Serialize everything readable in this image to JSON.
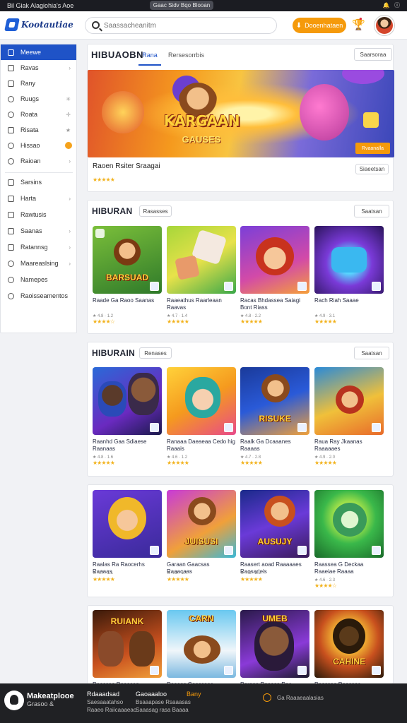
{
  "status_bar": {
    "left": "Bil Giak Alagiohia's Aoe",
    "center": "Gaac Sidv Bqo Blooan",
    "icons": [
      "bell-icon",
      "info-icon"
    ]
  },
  "header": {
    "logo_text": "Kootautiae",
    "search_placeholder": "Saassacheanitm",
    "download_label": "Dooenhataen",
    "colors": {
      "brand": "#1f53c7",
      "accent": "#f59a0b"
    }
  },
  "sidebar": {
    "items": [
      {
        "label": "Meewe",
        "active": true,
        "icon": "home-icon"
      },
      {
        "label": "Ravas",
        "icon": "grid-icon"
      },
      {
        "label": "Rany",
        "icon": "gamepad-icon"
      },
      {
        "label": "Ruugs",
        "icon": "puzzle-icon"
      },
      {
        "label": "Roata",
        "icon": "car-icon"
      },
      {
        "label": "Risata",
        "icon": "sword-icon"
      },
      {
        "label": "Hissao",
        "icon": "star-icon"
      },
      {
        "label": "Raioan",
        "icon": "trophy-icon"
      }
    ],
    "items2": [
      {
        "label": "Sarsins",
        "icon": "list-icon"
      },
      {
        "label": "Harta",
        "icon": "calendar-icon"
      },
      {
        "label": "Rawtusis",
        "icon": "image-icon"
      },
      {
        "label": "Saanas",
        "icon": "music-icon"
      },
      {
        "label": "Ratannsg",
        "icon": "chart-icon"
      },
      {
        "label": "Maareaslsing",
        "icon": "globe-icon"
      },
      {
        "label": "Namepes",
        "icon": "user-icon"
      },
      {
        "label": "Raoisseamentos",
        "icon": "settings-icon"
      }
    ]
  },
  "featured": {
    "title": "HIBUAOBN",
    "tabs": [
      "Rana",
      "Rersesorrbis"
    ],
    "view_all": "Saarsoraa",
    "banner_word": "KARGAAN",
    "banner_sub": "GAUSES",
    "banner_cta": "Rvaanalla",
    "name": "Raoen Rsiter Sraagai",
    "details_label": "Siaeetsan",
    "stars": "★★★★★"
  },
  "sections": [
    {
      "title": "HIBURAN",
      "filter": "Rasasses",
      "view_all": "Saatsan",
      "games": [
        {
          "name": "Raade Ga Raoo Saanas",
          "meta": "★ 4.8 · 1.2",
          "stars": "★★★★☆",
          "word": "BARSUAD"
        },
        {
          "name": "Raaeathus Raarleaan Raavas",
          "meta": "★ 4.7 · 1.4",
          "stars": "★★★★★",
          "word": ""
        },
        {
          "name": "Racas Bhdassea Saiagi Bont Riass",
          "meta": "★ 4.8 · 2.2",
          "stars": "★★★★★",
          "word": ""
        },
        {
          "name": "Rach Riah Saaae",
          "meta": "★ 4.9 · 3.1",
          "stars": "★★★★★",
          "word": ""
        }
      ]
    },
    {
      "title": "HIBURAIN",
      "filter": "Renases",
      "view_all": "Saatsan",
      "games": [
        {
          "name": "Raanhd Gaa Sdiaese Raanaas",
          "meta": "★ 4.8 · 1.6",
          "stars": "★★★★★",
          "word": ""
        },
        {
          "name": "Ranaaa Daeaeaa Cedo hig Raaais",
          "meta": "★ 4.6 · 1.2",
          "stars": "★★★★★",
          "word": ""
        },
        {
          "name": "Raalk Ga Dcaaanes Raaaas",
          "meta": "★ 4.7 · 2.8",
          "stars": "★★★★★",
          "word": "RISUKE"
        },
        {
          "name": "Raua Ray Jkaanas Raaaaaes",
          "meta": "★ 4.9 · 2.0",
          "stars": "★★★★★",
          "word": ""
        }
      ]
    },
    {
      "title": "",
      "filter": "",
      "view_all": "",
      "games": [
        {
          "name": "Raalas Ra Raocerhs Raaaas",
          "meta": "★ 4.7 · 1.1",
          "stars": "★★★★★",
          "word": ""
        },
        {
          "name": "Garaan Gaacsas Raaacaas",
          "meta": "★ 4.8 · 1.4",
          "stars": "★★★★★",
          "word": "JUISUSI"
        },
        {
          "name": "Raasert aoad Raaaaaes Raosarieis",
          "meta": "★ 4.8 · 2.2",
          "stars": "★★★★★",
          "word": "AUSUJY"
        },
        {
          "name": "Raassea G Deckaa Raaeiae Raaaa",
          "meta": "★ 4.6 · 2.3",
          "stars": "★★★★☆",
          "word": ""
        }
      ]
    },
    {
      "title": "",
      "filter": "",
      "view_all": "",
      "games": [
        {
          "name": "Raassaa Raaasan",
          "meta": "",
          "stars": "",
          "word": "RUIANK"
        },
        {
          "name": "Raaoos Gaassaos",
          "meta": "",
          "stars": "",
          "word": "CARN"
        },
        {
          "name": "Raraaa Raaasa Raa",
          "meta": "",
          "stars": "",
          "word": "UMEB"
        },
        {
          "name": "Raassaa Raosaos",
          "meta": "",
          "stars": "",
          "word": "CAHINE"
        }
      ]
    }
  ],
  "footer": {
    "brand": "Makeatplooe",
    "brand_sub": "Grasoo &",
    "col1": {
      "h": "Rdaaadsad",
      "l1": "Saesaaatahso",
      "l2": "Raaeo Raiicaaaeao"
    },
    "col2": {
      "h": "Gaoaaaloo",
      "l1": "Bsaaapase Rsaaasas",
      "l2": "Saaasag rasa Baaaa"
    },
    "col3": {
      "h": "Bany"
    },
    "note": "Ga Raaaeaalasias"
  }
}
